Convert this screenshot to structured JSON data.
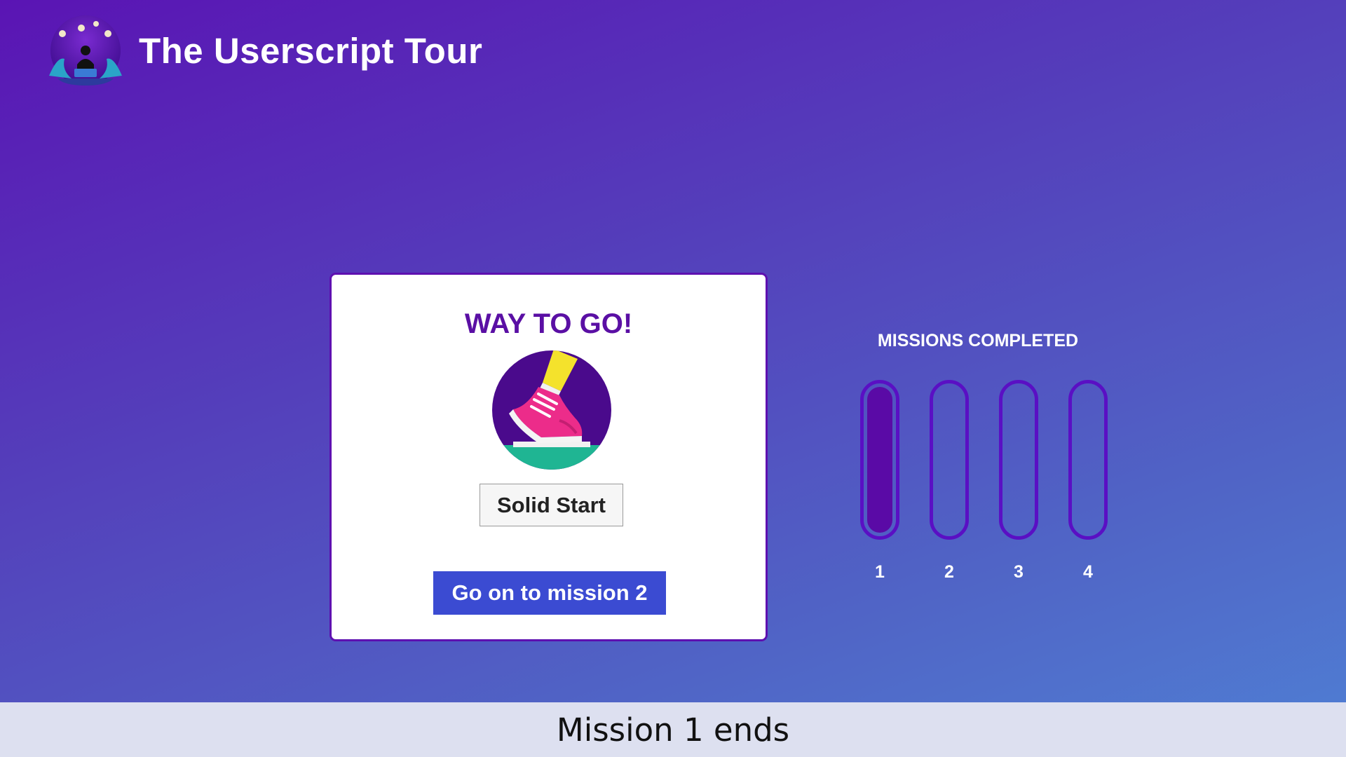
{
  "header": {
    "title": "The Userscript Tour",
    "logo_icon": "userscript-tour-logo"
  },
  "card": {
    "title": "WAY TO GO!",
    "badge_icon": "sneaker-step-icon",
    "badge_label": "Solid Start",
    "next_button_label": "Go on to mission 2",
    "colors": {
      "title": "#5a0fa4",
      "border": "#5e10b0",
      "button": "#3b4bd2"
    }
  },
  "missions": {
    "heading": "MISSIONS COMPLETED",
    "items": [
      {
        "number": "1",
        "completed": 1
      },
      {
        "number": "2",
        "completed": 0
      },
      {
        "number": "3",
        "completed": 0
      },
      {
        "number": "4",
        "completed": 0
      }
    ],
    "colors": {
      "outline": "#5a0fc4",
      "fill": "#5a0aa6"
    }
  },
  "caption": {
    "text": "Mission 1 ends"
  }
}
